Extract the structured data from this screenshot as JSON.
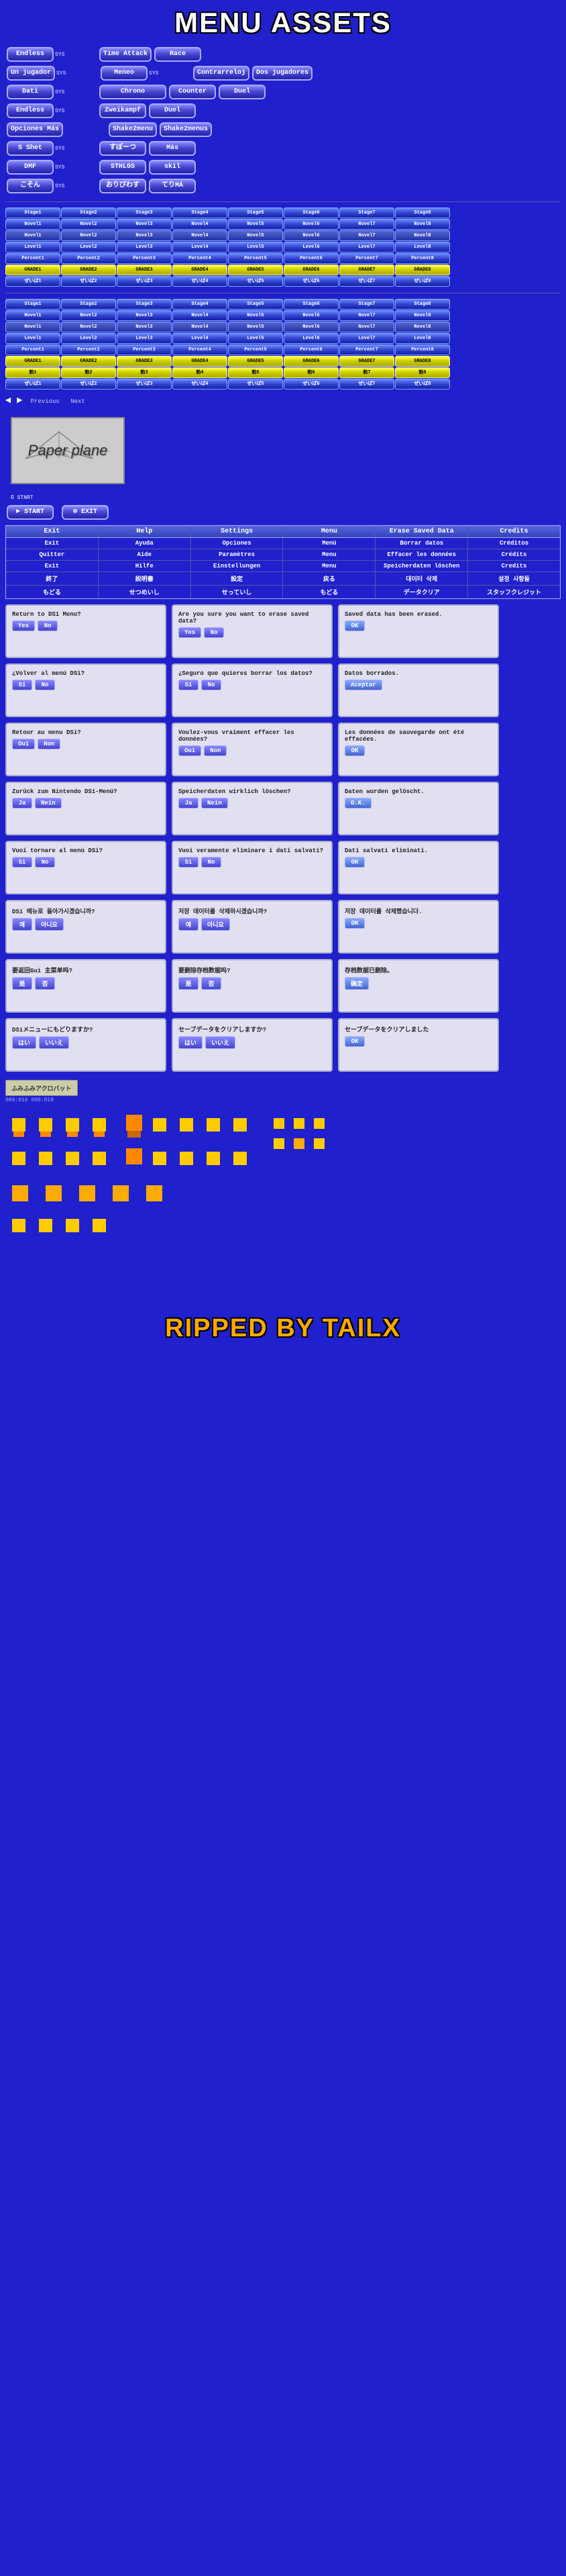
{
  "title": "MENU ASSETS",
  "footer_title": "RIPPED BY TAILX",
  "top_menu_rows": [
    {
      "items": [
        "Endless",
        "SYS",
        "Time Attack",
        "Race"
      ]
    },
    {
      "items": [
        "Un jugador",
        "SYS",
        "Meneo",
        "SYS",
        "Contrarreloj",
        "Dos jugadores"
      ]
    },
    {
      "items": [
        "Dati",
        "SYS",
        "Chrono",
        "Counter",
        "Duel"
      ]
    },
    {
      "items": [
        "Endless",
        "SYS",
        "Zweikampf",
        "Duel"
      ]
    },
    {
      "items": [
        "Opciones",
        "Más",
        "Shake2menu",
        "Shake2menus"
      ]
    },
    {
      "items": [
        "S Shet",
        "SYS",
        "すぽーつ",
        "Más"
      ]
    },
    {
      "items": [
        "DMF",
        "SYS",
        "STHLGS",
        "skil"
      ]
    },
    {
      "items": [
        "こそん",
        "SYS",
        "おりびわす",
        "てりMÁ"
      ]
    }
  ],
  "sprite_button_rows": [
    {
      "type": "stop",
      "items": [
        "Stage1",
        "Stage2",
        "Stage3",
        "Stage4",
        "Stage5",
        "Stage6",
        "Stage7",
        "Stage8"
      ]
    },
    {
      "type": "novel",
      "items": [
        "Novel1",
        "Novel2",
        "Novel3",
        "Novel4",
        "Novel5",
        "Novel6",
        "Novel7",
        "Novel8"
      ]
    },
    {
      "type": "novel2",
      "items": [
        "Novel1",
        "Novel2",
        "Novel3",
        "Novel4",
        "Novel5",
        "Novel6",
        "Novel7",
        "Novel8"
      ]
    },
    {
      "type": "level",
      "items": [
        "Level1",
        "Level2",
        "Level3",
        "Level4",
        "Level5",
        "Level6",
        "Level7",
        "Level8"
      ]
    },
    {
      "type": "percent",
      "items": [
        "Percent1",
        "Percent2",
        "Percent3",
        "Percent4",
        "Percent5",
        "Percent6",
        "Percent7",
        "Percent8"
      ]
    },
    {
      "type": "grade",
      "items": [
        "GRADE1",
        "GRADE2",
        "GRADE3",
        "GRADE4",
        "GRADE5",
        "GRADE6",
        "GRADE7",
        "GRADE8"
      ]
    },
    {
      "type": "zyappu",
      "items": [
        "ぜいぱ1",
        "ぜいぱ2",
        "ぜいぱ3",
        "ぜいぱ4",
        "ぜいぱ5",
        "ぜいぱ6",
        "ぜいぱ7",
        "ぜいぱ8"
      ]
    },
    {
      "type": "stop2",
      "items": [
        "Stage1",
        "Stage2",
        "Stage3",
        "Stage4",
        "Stage5",
        "Stage6",
        "Stage7",
        "Stage8"
      ]
    },
    {
      "type": "novel3",
      "items": [
        "Novel1",
        "Novel2",
        "Novel3",
        "Novel4",
        "Novel5",
        "Novel6",
        "Novel7",
        "Novel8"
      ]
    },
    {
      "type": "novel4",
      "items": [
        "Novel1",
        "Novel2",
        "Novel3",
        "Novel4",
        "Novel5",
        "Novel6",
        "Novel7",
        "Novel8"
      ]
    },
    {
      "type": "level2",
      "items": [
        "Level1",
        "Level2",
        "Level3",
        "Level4",
        "Level5",
        "Level6",
        "Level7",
        "Level8"
      ]
    },
    {
      "type": "percent2",
      "items": [
        "Percent1",
        "Percent2",
        "Percent3",
        "Percent4",
        "Percent5",
        "Percent6",
        "Percent7",
        "Percent8"
      ]
    },
    {
      "type": "grade2",
      "items": [
        "GRADE1",
        "GRADE2",
        "GRADE3",
        "GRADE4",
        "GRADE5",
        "GRADE6",
        "GRADE7",
        "GRADE8"
      ]
    },
    {
      "type": "num",
      "items": [
        "勅1",
        "勅2",
        "勅3",
        "勅4",
        "勅5",
        "勅6",
        "勅7",
        "勅8"
      ]
    },
    {
      "type": "zyappu2",
      "items": [
        "ぜいぱ1",
        "ぜいぱ2",
        "ぜいぱ3",
        "ぜいぱ4",
        "ぜいぱ5",
        "ぜいぱ6",
        "ぜいぱ7",
        "ぜいぱ8"
      ]
    }
  ],
  "nav_labels": [
    "Previous",
    "Next"
  ],
  "paper_plane": {
    "text": "Paper plane"
  },
  "start_exit": {
    "start": "► START",
    "exit": "⊗ EXIT"
  },
  "copyright": "© STNRT",
  "settings_table": {
    "headers": [
      "Exit",
      "Help",
      "Settings",
      "Menu",
      "Erase Saved Data",
      "Credits"
    ],
    "rows": [
      [
        "Exit",
        "Ayuda",
        "Opciones",
        "Menú",
        "Borrar datos",
        "Créditos"
      ],
      [
        "Quitter",
        "Aide",
        "Paramètres",
        "Menu",
        "Effacer les données",
        "Crédits"
      ],
      [
        "Exit",
        "Hilfe",
        "Einstellungen",
        "Menu",
        "Speicherdaten löschen",
        "Credits"
      ],
      [
        "終了",
        "説明書",
        "設定",
        "戻る",
        "대이터 삭제",
        "설정 사항들"
      ],
      [
        "もどる",
        "せつめいし",
        "せっていし",
        "もどる",
        "データクリア",
        "スタッフクレジット"
      ]
    ]
  },
  "dialogs": [
    {
      "lang": "en",
      "confirm": {
        "title": "Return to DSi Menu?",
        "buttons": [
          "Yes",
          "No"
        ]
      },
      "erase": {
        "title": "Are you sure you want to erase saved data?",
        "buttons": [
          "Yes",
          "No"
        ]
      },
      "erased": {
        "title": "Saved data has been erased.",
        "buttons": [
          "OK"
        ]
      }
    },
    {
      "lang": "es",
      "confirm": {
        "title": "¿Volver al menú DSi?",
        "buttons": [
          "Sí",
          "No"
        ]
      },
      "erase": {
        "title": "¿Seguro que quieres borrar los datos?",
        "buttons": [
          "Sí",
          "No"
        ]
      },
      "erased": {
        "title": "Datos borrados.",
        "buttons": [
          "Aceptar"
        ]
      }
    },
    {
      "lang": "fr",
      "confirm": {
        "title": "Retour au menu DSi?",
        "buttons": [
          "Oui",
          "Non"
        ]
      },
      "erase": {
        "title": "Voulez-vous vraiment effacer les données?",
        "buttons": [
          "Oui",
          "Non"
        ]
      },
      "erased": {
        "title": "Les données de sauvegarde ont été effacées.",
        "buttons": [
          "OK"
        ]
      }
    },
    {
      "lang": "de",
      "confirm": {
        "title": "Zurück zum Nintendo DSi-Menü?",
        "buttons": [
          "Ja",
          "Nein"
        ]
      },
      "erase": {
        "title": "Speicherdaten wirklich löschen?",
        "buttons": [
          "Ja",
          "Nein"
        ]
      },
      "erased": {
        "title": "Daten wurden gelöscht.",
        "buttons": [
          "O.K."
        ]
      }
    },
    {
      "lang": "it",
      "confirm": {
        "title": "Vuoi tornare al menù DSi?",
        "buttons": [
          "Sì",
          "No"
        ]
      },
      "erase": {
        "title": "Vuoi veramente eliminare i dati salvati?",
        "buttons": [
          "Sì",
          "No"
        ]
      },
      "erased": {
        "title": "Dati salvati eliminati.",
        "buttons": [
          "OK"
        ]
      }
    },
    {
      "lang": "ko",
      "confirm": {
        "title": "DSi 메뉴로 돌아가시겠습니까?",
        "buttons": [
          "예",
          "아니요"
        ]
      },
      "erase": {
        "title": "저장 데이터를 삭제하시겠습니까?",
        "buttons": [
          "예",
          "아니요"
        ]
      },
      "erased": {
        "title": "저장 데이터를 삭제했습니다.",
        "buttons": [
          "OK"
        ]
      }
    },
    {
      "lang": "zh",
      "confirm": {
        "title": "要返回Gui 主菜单吗?",
        "buttons": [
          "是",
          "否"
        ]
      },
      "erase": {
        "title": "要删除存档数据吗?",
        "buttons": [
          "是",
          "否"
        ]
      },
      "erased": {
        "title": "存档数据已删除。",
        "buttons": [
          "确定"
        ]
      }
    },
    {
      "lang": "ja",
      "confirm": {
        "title": "DSiメニューにもどりますか?",
        "buttons": [
          "はい",
          "いいえ"
        ]
      },
      "erase": {
        "title": "セーブデータをクリアしますか?",
        "buttons": [
          "はい",
          "いいえ"
        ]
      },
      "erased": {
        "title": "セーブデータをクリアしました",
        "buttons": [
          "OK"
        ]
      }
    }
  ],
  "bottom_label": "ふみふみアクロバット",
  "mini_counter": "000:016  000:018"
}
